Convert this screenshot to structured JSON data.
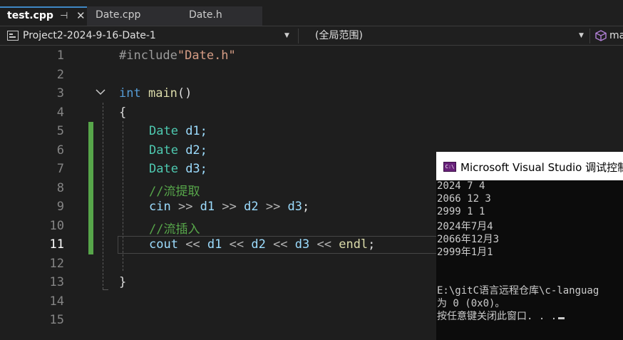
{
  "tabs": [
    {
      "label": "test.cpp",
      "pin": "⊣",
      "close": "✕"
    },
    {
      "label": "Date.cpp"
    },
    {
      "label": "Date.h"
    }
  ],
  "navbar": {
    "project": "Project2-2024-9-16-Date-1",
    "scope": "(全局范围)",
    "member": "ma"
  },
  "line_numbers": [
    "1",
    "2",
    "3",
    "4",
    "5",
    "6",
    "7",
    "8",
    "9",
    "10",
    "11",
    "12",
    "13",
    "14",
    "15"
  ],
  "current_line": "11",
  "code": {
    "l1_directive": "#include",
    "l1_file": "\"Date.h\"",
    "l3_kw": "int",
    "l3_fn": "main",
    "l3_paren": "()",
    "l4_brace": "{",
    "l5_type": "Date",
    "l5_var": " d1;",
    "l6_type": "Date",
    "l6_var": " d2;",
    "l7_type": "Date",
    "l7_var": " d3;",
    "l8_comment": "//流提取",
    "l9": {
      "cin": "cin",
      "op1": " >> ",
      "d1": "d1",
      "op2": " >> ",
      "d2": "d2",
      "op3": " >> ",
      "d3": "d3",
      "end": ";"
    },
    "l10_comment": "//流插入",
    "l11": {
      "cout": "cout",
      "op1": " << ",
      "d1": "d1",
      "op2": " << ",
      "d2": "d2",
      "op3": " << ",
      "d3": "d3",
      "op4": " << ",
      "endl": "endl",
      "end": ";"
    },
    "l13_brace": "}"
  },
  "console": {
    "title": "Microsoft Visual Studio 调试控制",
    "icon_text": "C:\\",
    "lines": [
      "2024 7 4",
      "2066 12 3",
      "2999 1 1",
      "2024年7月4",
      "2066年12月3",
      "2999年1月1",
      "",
      "E:\\gitC语言远程仓库\\c-languag",
      "为 0 (0x0)。",
      "按任意键关闭此窗口. . ."
    ]
  },
  "colors": {
    "keyword": "#569cd6",
    "function": "#dcdcaa",
    "type": "#4ec9b0",
    "variable": "#9cdcfe",
    "string": "#d69d85",
    "comment": "#57a64a",
    "change_marker": "#57a64a",
    "tab_accent": "#3f88c5"
  }
}
